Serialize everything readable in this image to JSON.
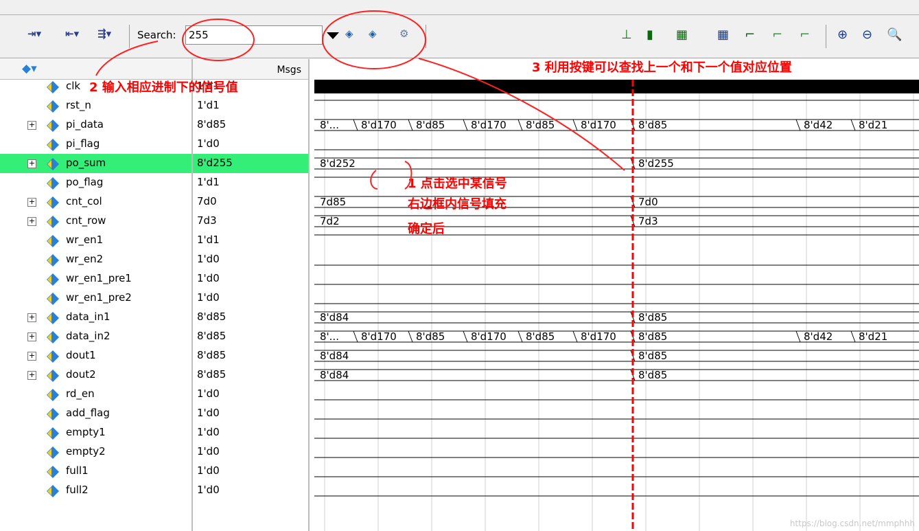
{
  "toolbar": {
    "search_label": "Search:",
    "search_value": "255",
    "icons": [
      "find-prev-icon",
      "find-next-icon",
      "find-settings-icon",
      "binoculars-prev-icon",
      "binoculars-next-icon",
      "search-tool-icon"
    ]
  },
  "panels": {
    "msgs_header": "Msgs"
  },
  "signals": [
    {
      "name": "clk",
      "value": "1'd1",
      "expandable": false
    },
    {
      "name": "rst_n",
      "value": "1'd1",
      "expandable": false
    },
    {
      "name": "pi_data",
      "value": "8'd85",
      "expandable": true
    },
    {
      "name": "pi_flag",
      "value": "1'd0",
      "expandable": false
    },
    {
      "name": "po_sum",
      "value": "8'd255",
      "expandable": true,
      "selected": true
    },
    {
      "name": "po_flag",
      "value": "1'd1",
      "expandable": false
    },
    {
      "name": "cnt_col",
      "value": "7d0",
      "expandable": true
    },
    {
      "name": "cnt_row",
      "value": "7d3",
      "expandable": true
    },
    {
      "name": "wr_en1",
      "value": "1'd1",
      "expandable": false
    },
    {
      "name": "wr_en2",
      "value": "1'd0",
      "expandable": false
    },
    {
      "name": "wr_en1_pre1",
      "value": "1'd0",
      "expandable": false
    },
    {
      "name": "wr_en1_pre2",
      "value": "1'd0",
      "expandable": false
    },
    {
      "name": "data_in1",
      "value": "8'd85",
      "expandable": true
    },
    {
      "name": "data_in2",
      "value": "8'd85",
      "expandable": true
    },
    {
      "name": "dout1",
      "value": "8'd85",
      "expandable": true
    },
    {
      "name": "dout2",
      "value": "8'd85",
      "expandable": true
    },
    {
      "name": "rd_en",
      "value": "1'd0",
      "expandable": false
    },
    {
      "name": "add_flag",
      "value": "1'd0",
      "expandable": false
    },
    {
      "name": "empty1",
      "value": "1'd0",
      "expandable": false
    },
    {
      "name": "empty2",
      "value": "1'd0",
      "expandable": false
    },
    {
      "name": "full1",
      "value": "1'd0",
      "expandable": false
    },
    {
      "name": "full2",
      "value": "1'd0",
      "expandable": false
    }
  ],
  "waves": {
    "pi_data": [
      "8'...",
      "8'd170",
      "8'd85",
      "8'd170",
      "8'd85",
      "8'd170",
      "8'd85",
      "8'd42",
      "8'd21"
    ],
    "po_sum": [
      "8'd252",
      "8'd255"
    ],
    "cnt_col": [
      "7d85",
      "7d0"
    ],
    "cnt_row": [
      "7d2",
      "7d3"
    ],
    "data_in1": [
      "8'd84",
      "8'd85"
    ],
    "data_in2": [
      "8'...",
      "8'd170",
      "8'd85",
      "8'd170",
      "8'd85",
      "8'd170",
      "8'd85",
      "8'd42",
      "8'd21"
    ],
    "dout1": [
      "8'd84",
      "8'd85"
    ],
    "dout2": [
      "8'd84",
      "8'd85"
    ]
  },
  "annotations": {
    "a1": "1 点击选中某信号",
    "a1b": "右边框内信号填充",
    "a1c": "确定后",
    "a2": "2 输入相应进制下的信号值",
    "a3": "3 利用按键可以查找上一个和下一个值对应位置"
  },
  "watermark": "https://blog.csdn.net/mmphhh",
  "colors": {
    "selected": "#33ee77",
    "cursor": "#ff0000",
    "annotation": "#ff0000",
    "signal_icon": "#2a7fd6"
  }
}
